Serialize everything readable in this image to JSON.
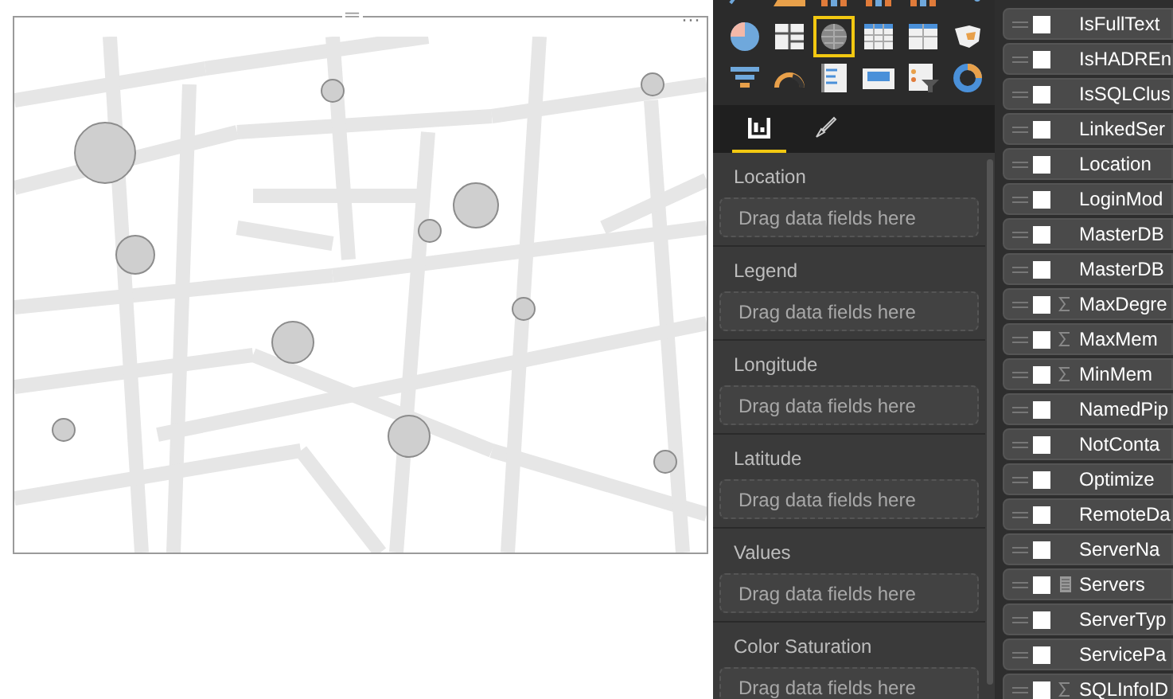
{
  "visual": {
    "drag_handle": "═",
    "more_options": "···"
  },
  "visualizations": [
    {
      "kind": "line",
      "selected": false
    },
    {
      "kind": "area",
      "selected": false
    },
    {
      "kind": "bar",
      "selected": false
    },
    {
      "kind": "bar",
      "selected": false
    },
    {
      "kind": "bar",
      "selected": false
    },
    {
      "kind": "scatter",
      "selected": false
    },
    {
      "kind": "pie",
      "selected": false
    },
    {
      "kind": "treemap",
      "selected": false
    },
    {
      "kind": "map",
      "selected": true
    },
    {
      "kind": "table",
      "selected": false
    },
    {
      "kind": "matrix",
      "selected": false
    },
    {
      "kind": "filledmap",
      "selected": false
    },
    {
      "kind": "funnel",
      "selected": false
    },
    {
      "kind": "gauge",
      "selected": false
    },
    {
      "kind": "multirow",
      "selected": false
    },
    {
      "kind": "card",
      "selected": false
    },
    {
      "kind": "slicer",
      "selected": false
    },
    {
      "kind": "donut",
      "selected": false
    }
  ],
  "pane_tabs": [
    {
      "kind": "fields",
      "selected": true
    },
    {
      "kind": "format",
      "selected": false
    }
  ],
  "wells": [
    {
      "label": "Location",
      "hint": "Drag data fields here"
    },
    {
      "label": "Legend",
      "hint": "Drag data fields here"
    },
    {
      "label": "Longitude",
      "hint": "Drag data fields here"
    },
    {
      "label": "Latitude",
      "hint": "Drag data fields here"
    },
    {
      "label": "Values",
      "hint": "Drag data fields here"
    },
    {
      "label": "Color Saturation",
      "hint": "Drag data fields here"
    }
  ],
  "fields": [
    {
      "name": "IsFullText",
      "kind": "text",
      "checked": false
    },
    {
      "name": "IsHADREn",
      "kind": "text",
      "checked": false
    },
    {
      "name": "IsSQLClus",
      "kind": "text",
      "checked": false
    },
    {
      "name": "LinkedSer",
      "kind": "text",
      "checked": false
    },
    {
      "name": "Location",
      "kind": "text",
      "checked": false
    },
    {
      "name": "LoginMod",
      "kind": "text",
      "checked": false
    },
    {
      "name": "MasterDB",
      "kind": "text",
      "checked": false
    },
    {
      "name": "MasterDB",
      "kind": "text",
      "checked": false
    },
    {
      "name": "MaxDegre",
      "kind": "sum",
      "checked": false
    },
    {
      "name": "MaxMem",
      "kind": "sum",
      "checked": false
    },
    {
      "name": "MinMem",
      "kind": "sum",
      "checked": false
    },
    {
      "name": "NamedPip",
      "kind": "text",
      "checked": false
    },
    {
      "name": "NotConta",
      "kind": "text",
      "checked": false
    },
    {
      "name": "Optimize",
      "kind": "text",
      "checked": false
    },
    {
      "name": "RemoteDa",
      "kind": "text",
      "checked": false
    },
    {
      "name": "ServerNa",
      "kind": "text",
      "checked": false
    },
    {
      "name": "Servers",
      "kind": "calc",
      "checked": false
    },
    {
      "name": "ServerTyp",
      "kind": "text",
      "checked": false
    },
    {
      "name": "ServicePa",
      "kind": "text",
      "checked": false
    },
    {
      "name": "SQLInfoID",
      "kind": "sum",
      "checked": false
    }
  ]
}
